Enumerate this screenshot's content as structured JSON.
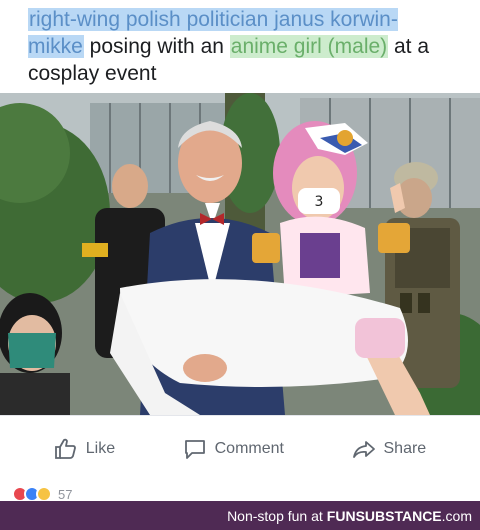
{
  "post": {
    "caption_part1": "right-wing polish politician janus korwin-mikke",
    "caption_part2": " posing with an ",
    "caption_part3": "anime girl (male)",
    "caption_part4": " at a cosplay event"
  },
  "photo": {
    "mask_text": "3"
  },
  "actions": {
    "like_label": "Like",
    "comment_label": "Comment",
    "share_label": "Share"
  },
  "reactions": {
    "count": "57"
  },
  "footer": {
    "text": "Non-stop fun at",
    "brand": "FUNSUBSTANCE",
    "domain": ".com"
  },
  "colors": {
    "highlight_blue": "#b9d8f5",
    "highlight_green": "#cdeccd",
    "footer_bg": "#4f2a54",
    "action_text": "#606770"
  }
}
